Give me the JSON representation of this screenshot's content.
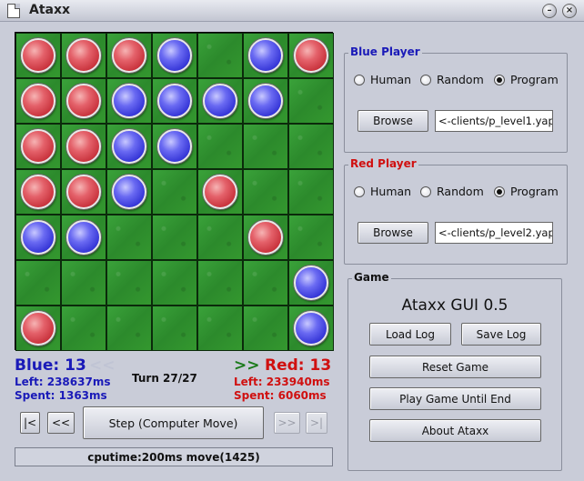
{
  "window": {
    "title": "Ataxx"
  },
  "board": {
    "rows": [
      [
        "red",
        "red",
        "red",
        "blue",
        "",
        "blue",
        "red"
      ],
      [
        "red",
        "red",
        "blue",
        "blue",
        "blue",
        "blue",
        ""
      ],
      [
        "red",
        "red",
        "blue",
        "blue",
        "",
        "",
        ""
      ],
      [
        "red",
        "red",
        "blue",
        "",
        "red",
        "",
        ""
      ],
      [
        "blue",
        "blue",
        "",
        "",
        "",
        "red",
        ""
      ],
      [
        "",
        "",
        "",
        "",
        "",
        "",
        "blue"
      ],
      [
        "red",
        "",
        "",
        "",
        "",
        "",
        "blue"
      ]
    ]
  },
  "blue": {
    "score_label": "Blue: 13",
    "arrow": "<<",
    "left": "Left: 238637ms",
    "spent": "Spent: 1363ms"
  },
  "red": {
    "score_label": "Red: 13",
    "arrow": ">>",
    "left": "Left: 233940ms",
    "spent": "Spent: 6060ms"
  },
  "turn": "Turn 27/27",
  "controls": {
    "first": "|<",
    "prev": "<<",
    "step": "Step (Computer Move)",
    "next": ">>",
    "last": ">|"
  },
  "status": "cputime:200ms move(1425)",
  "blue_player": {
    "title": "Blue Player",
    "options": [
      "Human",
      "Random",
      "Program"
    ],
    "selected": "Program",
    "browse": "Browse",
    "path": "<-clients/p_level1.yap"
  },
  "red_player": {
    "title": "Red Player",
    "options": [
      "Human",
      "Random",
      "Program"
    ],
    "selected": "Program",
    "browse": "Browse",
    "path": "<-clients/p_level2.yap"
  },
  "game": {
    "title": "Game",
    "app_title": "Ataxx GUI 0.5",
    "load_log": "Load Log",
    "save_log": "Save Log",
    "reset": "Reset Game",
    "play_until_end": "Play Game Until End",
    "about": "About Ataxx"
  },
  "colors": {
    "blue_text": "#1a1ab8",
    "red_text": "#d01010",
    "board_green": "#2c8a2c"
  }
}
